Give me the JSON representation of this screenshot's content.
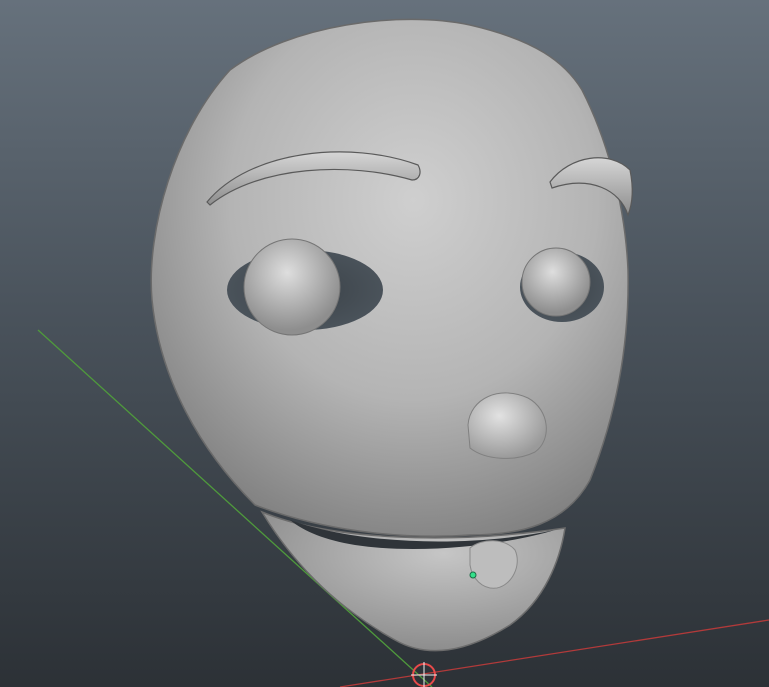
{
  "viewport": {
    "background_top": "#66717c",
    "background_bottom": "#2c3136"
  },
  "axes": {
    "x_axis_color": "#b23a3a",
    "z_axis_color": "#4f9a3c"
  },
  "model": {
    "surface_color": "#a7a7a7",
    "selected_vertex_color": "#33e08a"
  },
  "manipulator": {
    "icon": "pivot-target-icon",
    "color": "#e84a4a"
  }
}
